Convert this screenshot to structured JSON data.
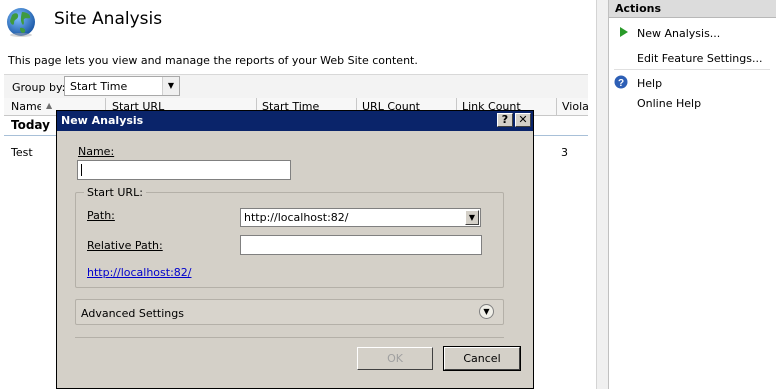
{
  "page": {
    "title": "Site Analysis",
    "description": "This page lets you view and manage the reports of your Web Site content."
  },
  "group_bar": {
    "label": "Group by:",
    "selected": "Start Time"
  },
  "grid": {
    "columns": [
      "Name",
      "Start URL",
      "Start Time",
      "URL Count",
      "Link Count",
      "Violat"
    ],
    "groups": [
      {
        "label": "Today",
        "rows": [
          {
            "name": "Test",
            "violations": "3"
          }
        ]
      }
    ]
  },
  "actions": {
    "title": "Actions",
    "items": [
      {
        "label": "New Analysis...",
        "icon": "play-icon"
      },
      {
        "label": "Edit Feature Settings...",
        "icon": ""
      },
      {
        "label": "Help",
        "icon": "help-icon"
      },
      {
        "label": "Online Help",
        "icon": ""
      }
    ]
  },
  "dialog": {
    "title": "New Analysis",
    "name_label": "Name:",
    "name_value": "",
    "start_url_group": "Start URL:",
    "path_label": "Path:",
    "path_value": "http://localhost:82/",
    "relative_path_label": "Relative Path:",
    "relative_path_value": "",
    "url_preview": "http://localhost:82/",
    "advanced_label": "Advanced Settings",
    "ok_label": "OK",
    "cancel_label": "Cancel",
    "help_glyph": "?",
    "close_glyph": "✕"
  },
  "colors": {
    "dialog_title_bg": "#0a246a",
    "dialog_bg": "#d4d0c8",
    "link": "#0000cc",
    "play_icon": "#2a9a2a"
  }
}
